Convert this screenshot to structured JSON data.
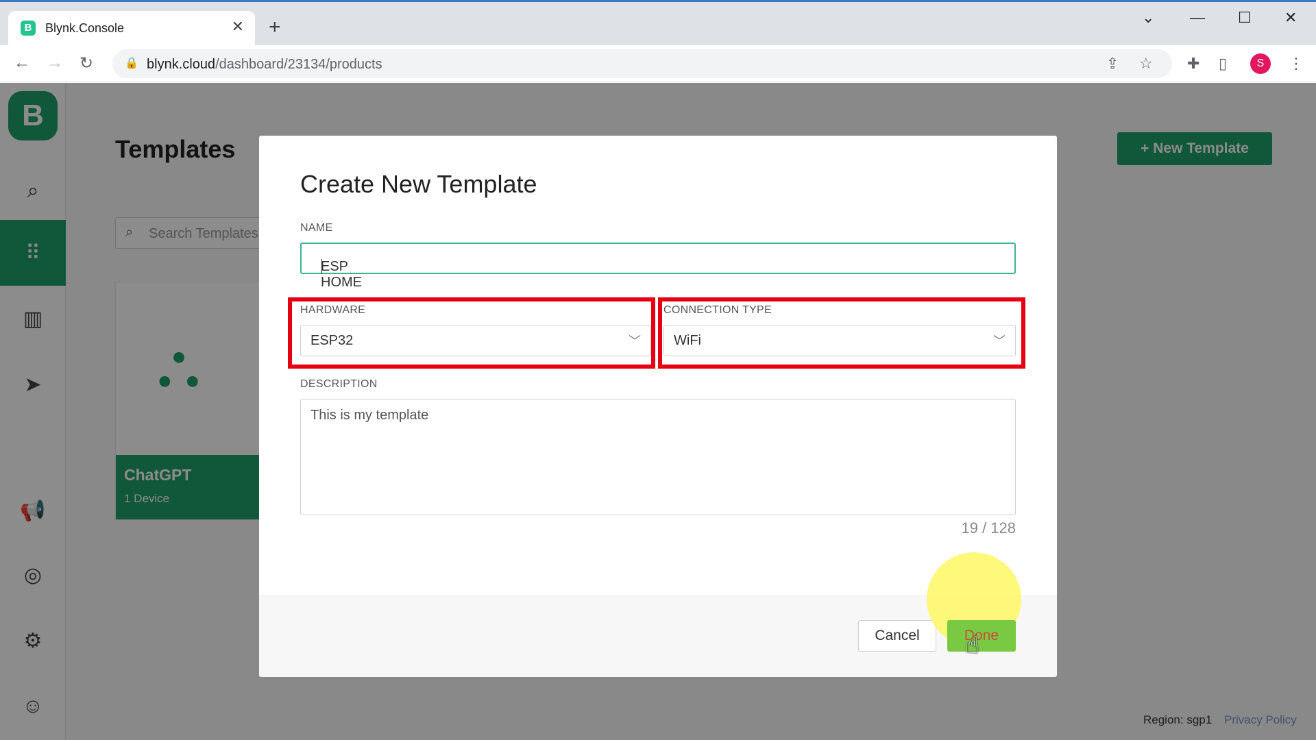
{
  "browser": {
    "tab_title": "Blynk.Console",
    "tab_favicon": "B",
    "url_host": "blynk.cloud",
    "url_path": "/dashboard/23134/products",
    "profile_initial": "S"
  },
  "sidebar": {
    "logo": "B",
    "items": [
      "search-icon",
      "templates-grid-icon",
      "organization-icon",
      "send-icon",
      "announcement-icon",
      "help-icon",
      "settings-icon",
      "user-icon"
    ]
  },
  "page": {
    "title": "Templates",
    "new_template_label": "New Template",
    "search_placeholder": "Search Templates",
    "card": {
      "name": "ChatGPT",
      "devices": "1 Device"
    },
    "region": "Region: sgp1",
    "privacy": "Privacy Policy"
  },
  "modal": {
    "title": "Create New Template",
    "name_label": "NAME",
    "name_value": "ESP HOME",
    "hardware_label": "HARDWARE",
    "hardware_value": "ESP32",
    "connection_label": "CONNECTION TYPE",
    "connection_value": "WiFi",
    "description_label": "DESCRIPTION",
    "description_value": "This is my template",
    "counter": "19 / 128",
    "cancel_label": "Cancel",
    "done_label": "Done"
  },
  "colors": {
    "brand": "#1f9f68",
    "annotation": "#e60012",
    "done": "#7ac943"
  }
}
